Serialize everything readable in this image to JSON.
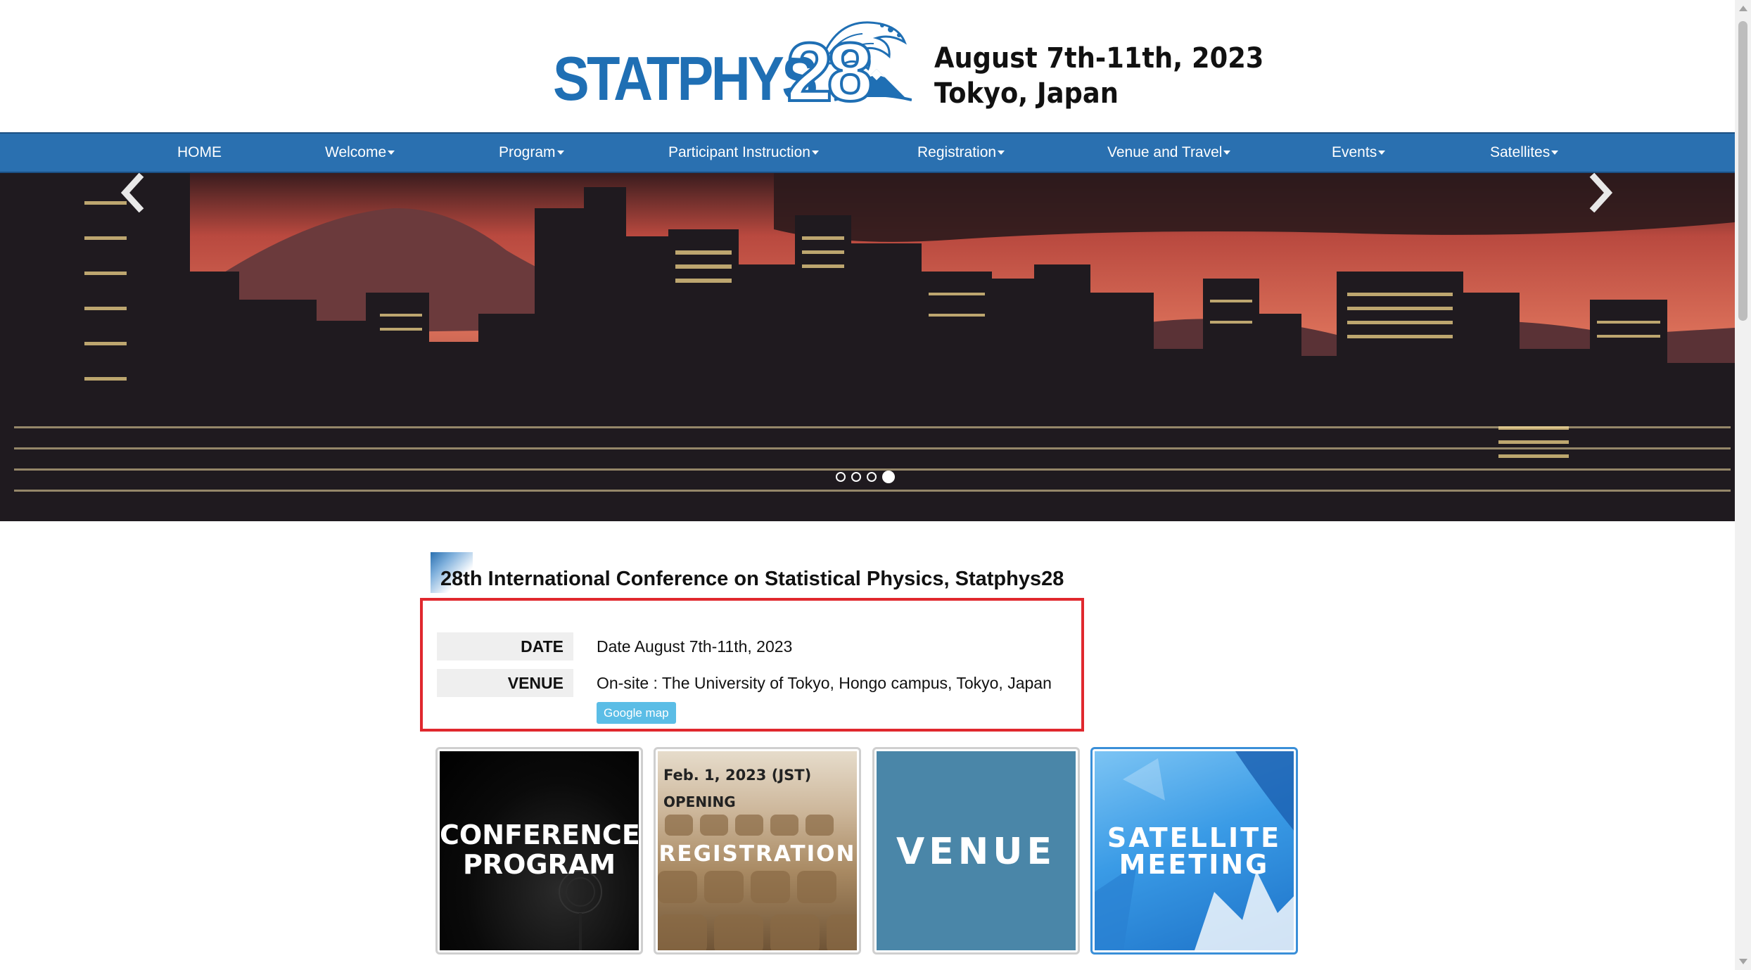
{
  "header": {
    "logo_text": "STATPHYS",
    "logo_number": "28",
    "date_line": "August 7th-11th, 2023",
    "location_line": "Tokyo, Japan"
  },
  "nav": {
    "items": [
      {
        "label": "HOME",
        "dropdown": false
      },
      {
        "label": "Welcome",
        "dropdown": true
      },
      {
        "label": "Program",
        "dropdown": true
      },
      {
        "label": "Participant Instruction",
        "dropdown": true
      },
      {
        "label": "Registration",
        "dropdown": true
      },
      {
        "label": "Venue and Travel",
        "dropdown": true
      },
      {
        "label": "Events",
        "dropdown": true
      },
      {
        "label": "Satellites",
        "dropdown": true
      }
    ]
  },
  "carousel": {
    "slide_count": 4,
    "active_index": 3,
    "prev_icon": "chevron-left-icon",
    "next_icon": "chevron-right-icon"
  },
  "main": {
    "title": "28th International Conference on Statistical Physics, Statphys28",
    "date_label": "DATE",
    "date_value": "Date August 7th-11th, 2023",
    "venue_label": "VENUE",
    "venue_value": "On-site : The University of Tokyo, Hongo campus, Tokyo, Japan",
    "map_button": "Google map"
  },
  "tiles": [
    {
      "line1": "CONFERENCE",
      "line2": "PROGRAM"
    },
    {
      "sub1": "Feb. 1, 2023 (JST)",
      "sub2": "OPENING",
      "line1": "REGISTRATION"
    },
    {
      "line1": "VENUE"
    },
    {
      "line1": "SATELLITE",
      "line2": "MEETING"
    }
  ],
  "colors": {
    "nav_bg": "#2a70b0",
    "logo_blue": "#1f6fb4",
    "highlight_border": "#e0282e",
    "map_button_bg": "#5bbde6",
    "venue_tile_bg": "#4a86a8",
    "satellite_tile_bg": "#3a9be6"
  }
}
